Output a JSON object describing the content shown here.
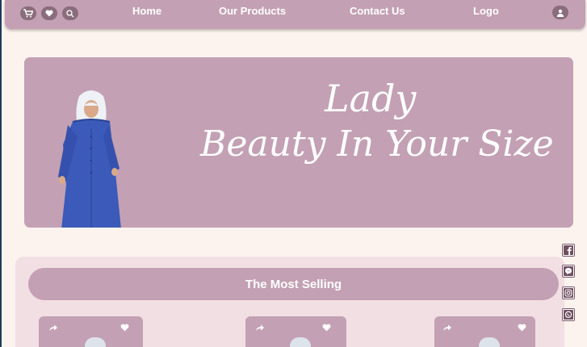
{
  "nav": {
    "links": [
      "Home",
      "Our Products",
      "Contact Us",
      "Logo"
    ],
    "icons": [
      "cart-icon",
      "heart-icon",
      "search-icon",
      "user-icon"
    ]
  },
  "hero": {
    "line1": "Lady",
    "line2": "Beauty In Your Size"
  },
  "most_selling": {
    "title": "The Most Selling",
    "cards": [
      {
        "share_icon": "share-icon",
        "fav_icon": "heart-icon"
      },
      {
        "share_icon": "share-icon",
        "fav_icon": "heart-icon"
      },
      {
        "share_icon": "share-icon",
        "fav_icon": "heart-icon"
      }
    ]
  },
  "social": [
    "facebook-icon",
    "messenger-icon",
    "instagram-icon",
    "whatsapp-icon"
  ],
  "colors": {
    "accent": "#c3a0b3",
    "background": "#fdf3ee",
    "section_bg": "#f2dfe3",
    "icon_bg": "#8a6d7c"
  }
}
